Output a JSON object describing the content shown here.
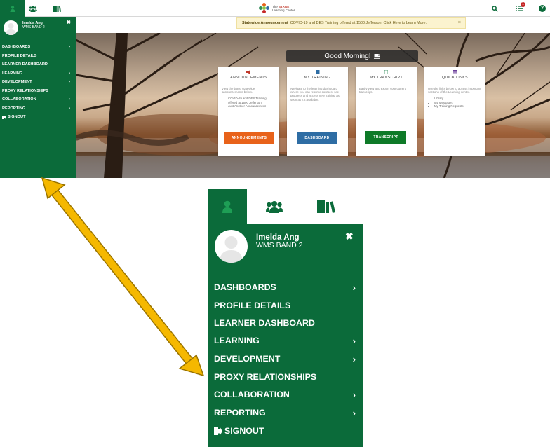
{
  "navbar": {
    "logo_line1": "The",
    "logo_brand": "STAGE",
    "logo_line2": "Learning Center",
    "notification_count": "1",
    "help_glyph": "?"
  },
  "announcement": {
    "label": "Statewide Announcement",
    "text": "COVID-19 and DES Training offered at 1500 Jefferson. Click Here to Learn More.",
    "close": "×"
  },
  "hero": {
    "greeting": "Good Morning!"
  },
  "cards": [
    {
      "title": "ANNOUNCEMENTS",
      "desc": "View the latest statewide announcements below.",
      "items": [
        "COVID-19 and DES Training offered at 1500 Jefferson",
        "Just Another Announcement"
      ],
      "button": "ANNOUNCEMENTS",
      "button_color": "#e8621a"
    },
    {
      "title": "MY TRAINING",
      "desc": "Navigate to the learning dashboard where you can resume courses, see progress and access new training as soon as it's available.",
      "button": "DASHBOARD",
      "button_color": "#2e6da4"
    },
    {
      "title": "MY TRANSCRIPT",
      "desc": "Easily view and export your current transcript.",
      "button": "TRANSCRIPT",
      "button_color": "#0e7a28"
    },
    {
      "title": "QUICK LINKS",
      "desc": "Use the links below to access important sections of the Learning center.",
      "items": [
        "Library",
        "My Messages",
        "My Training Requests"
      ]
    }
  ],
  "user": {
    "name": "Imelda Ang",
    "band": "WMS BAND 2"
  },
  "sidebar": {
    "close": "✖",
    "items": [
      {
        "label": "DASHBOARDS",
        "chevron": true
      },
      {
        "label": "PROFILE DETAILS",
        "chevron": false
      },
      {
        "label": "LEARNER DASHBOARD",
        "chevron": false
      },
      {
        "label": "LEARNING",
        "chevron": true
      },
      {
        "label": "DEVELOPMENT",
        "chevron": true
      },
      {
        "label": "PROXY RELATIONSHIPS",
        "chevron": false
      },
      {
        "label": "COLLABORATION",
        "chevron": true
      },
      {
        "label": "REPORTING",
        "chevron": true
      },
      {
        "label": "SIGNOUT",
        "chevron": false,
        "icon": "signout-icon"
      }
    ]
  },
  "colors": {
    "brand_green": "#0b6b3a",
    "arrow_yellow": "#f5b800"
  }
}
